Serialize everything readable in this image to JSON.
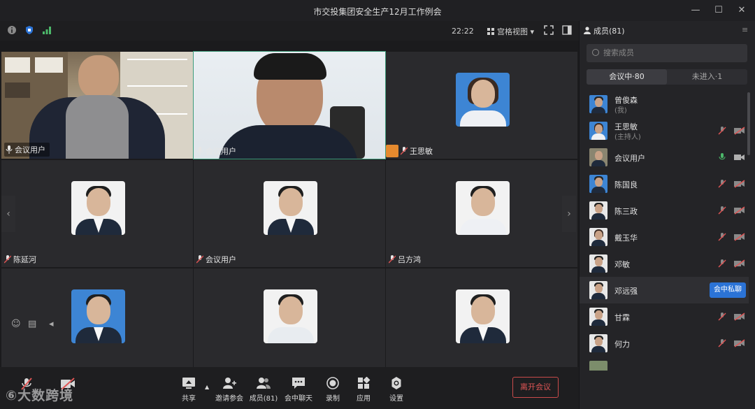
{
  "window": {
    "title": "市交投集团安全生产12月工作例会"
  },
  "toolbar": {
    "time": "22:22",
    "view_label": "宫格视图"
  },
  "tiles": [
    {
      "name": "会议用户"
    },
    {
      "name": "会议用户"
    },
    {
      "name": "王思敏"
    },
    {
      "name": "陈延河"
    },
    {
      "name": "会议用户"
    },
    {
      "name": "吕方鸿"
    }
  ],
  "bottom": {
    "share": "共享",
    "invite": "邀请参会",
    "members": "成员(81)",
    "chat": "会中聊天",
    "record": "录制",
    "apps": "应用",
    "settings": "设置",
    "leave": "离开会议",
    "watermark": "⑥大数跨境"
  },
  "panel": {
    "title": "成员(81)",
    "search_placeholder": "搜索成员",
    "tab_in": "会议中·80",
    "tab_out": "未进入·1",
    "members": [
      {
        "name": "曾俊森",
        "sub": "(我)"
      },
      {
        "name": "王思敏",
        "sub": "(主持人)"
      },
      {
        "name": "会议用户",
        "sub": ""
      },
      {
        "name": "陈国良",
        "sub": ""
      },
      {
        "name": "陈三政",
        "sub": ""
      },
      {
        "name": "戴玉华",
        "sub": ""
      },
      {
        "name": "邓敏",
        "sub": ""
      },
      {
        "name": "邓远强",
        "sub": ""
      },
      {
        "name": "甘霖",
        "sub": ""
      },
      {
        "name": "何力",
        "sub": ""
      }
    ],
    "private_chat": "会中私聊"
  },
  "colors": {
    "accent": "#2b73d6",
    "leave": "#e05555",
    "mic_on": "#4cb86a",
    "host": "#e58a2e"
  }
}
